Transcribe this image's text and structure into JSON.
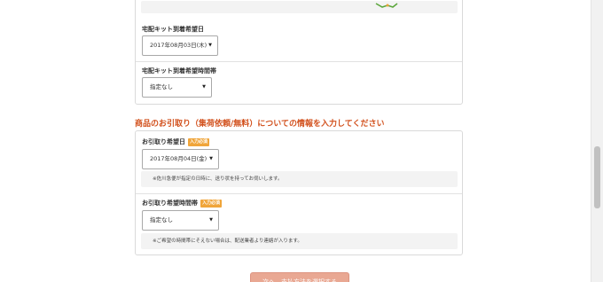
{
  "delivery_kit": {
    "date_label": "宅配キット到着希望日",
    "date_value": "2017年08月03日(木)",
    "time_label": "宅配キット到着希望時間帯",
    "time_value": "指定なし"
  },
  "pickup_section": {
    "heading": "商品のお引取り（集荷依頼/無料）についての情報を入力してください",
    "date_label": "お引取り希望日",
    "date_badge": "入力必須",
    "date_value": "2017年08月04日(金)",
    "date_note": "※佐川急便が指定の日時に、送り状を持ってお伺いします。",
    "time_label": "お引取り希望時間帯",
    "time_badge": "入力必須",
    "time_value": "指定なし",
    "time_note": "※ご希望の時間帯にそえない場合は、配送業者より連絡が入ります。"
  },
  "footer": {
    "next_label": "次へ　支払方法を選択する"
  },
  "colors": {
    "heading": "#d2501c",
    "badge": "#f0a53a",
    "next_button": "#e9a893"
  }
}
